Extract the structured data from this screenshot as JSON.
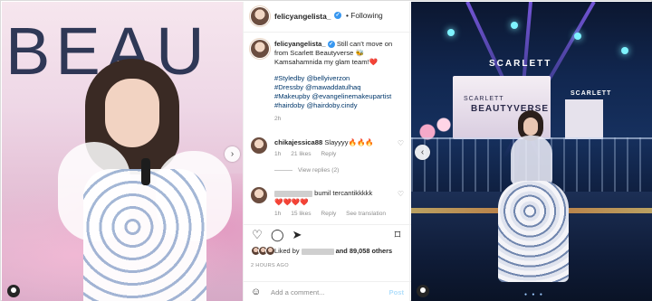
{
  "left_photo": {
    "backdrop_text": "BEAU",
    "next_arrow": "›"
  },
  "post": {
    "header": {
      "username": "felicyangelista_",
      "verified_mark": "✓",
      "separator": "•",
      "follow_label": "Following"
    },
    "caption": {
      "username": "felicyangelista_",
      "text": "Still can't move on from Scarlett Beautyverse 🐝 Kamsahamnida my glam team!❤️",
      "tags": [
        "#Styledby @bellyiverzon",
        "#Dressby @mawaddatulhaq",
        "#Makeupby @evangelinemakeupartist",
        "#hairdoby @hairdoby.cindy"
      ],
      "time": "2h"
    },
    "comments": [
      {
        "username": "chikajessica88",
        "text": "Slayyyy🔥🔥🔥",
        "time": "1h",
        "likes": "21 likes",
        "reply": "Reply",
        "view_replies": "View replies (2)"
      },
      {
        "text_line1": "bumil tercantikkkkk",
        "text_line2": "❤️❤️❤️❤️",
        "time": "1h",
        "likes": "15 likes",
        "reply": "Reply",
        "translate": "See translation"
      }
    ],
    "actions": {
      "like_icon": "♡",
      "comment_icon": "◯",
      "share_icon": "➤",
      "save_icon": "⌑"
    },
    "likes": {
      "prefix": "Liked by",
      "suffix": "and 89,058 others"
    },
    "ago": "2 HOURS AGO",
    "add_comment": {
      "emoji_icon": "☺",
      "placeholder": "Add a comment...",
      "post_label": "Post"
    }
  },
  "right_photo": {
    "logo_top": "SCARLETT",
    "screen_line1": "SCARLETT",
    "screen_line2": "BEAUTYVERSE",
    "logo_side": "SCARLETT",
    "prev_arrow": "‹",
    "pagination": "● ● ●"
  },
  "colors": {
    "link": "#00376b",
    "verified": "#3897f0",
    "muted": "#8e8e8e",
    "post_button": "#b2dffc"
  }
}
